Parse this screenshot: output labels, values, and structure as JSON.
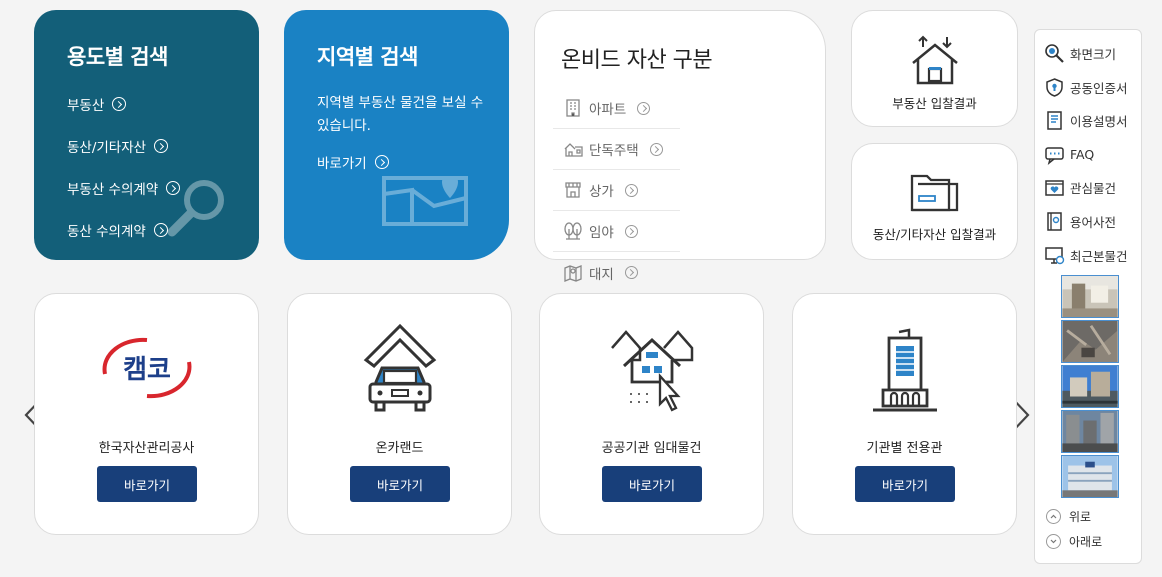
{
  "usage_search": {
    "title": "용도별 검색",
    "links": [
      "부동산",
      "동산/기타자산",
      "부동산 수의계약",
      "동산 수의계약"
    ]
  },
  "region_search": {
    "title": "지역별 검색",
    "description": "지역별 부동산 물건을 보실 수 있습니다.",
    "go_label": "바로가기"
  },
  "asset_types": {
    "title": "온비드 자산 구분",
    "items": [
      {
        "label": "아파트",
        "icon": "apartment-icon"
      },
      {
        "label": "단독주택",
        "icon": "house-icon"
      },
      {
        "label": "상가",
        "icon": "store-icon"
      },
      {
        "label": "임야",
        "icon": "forest-icon"
      },
      {
        "label": "대지",
        "icon": "land-icon"
      }
    ]
  },
  "results": {
    "realestate": "부동산 입찰결과",
    "movable": "동산/기타자산 입찰결과"
  },
  "quick_menu": {
    "items": [
      "화면크기",
      "공동인증서",
      "이용설명서",
      "FAQ",
      "관심물건",
      "용어사전",
      "최근본물건"
    ],
    "up_label": "위로",
    "down_label": "아래로"
  },
  "shortcuts": [
    {
      "title": "한국자산관리공사",
      "button": "바로가기",
      "logo_text": "캠코"
    },
    {
      "title": "온카랜드",
      "button": "바로가기"
    },
    {
      "title": "공공기관 임대물건",
      "button": "바로가기"
    },
    {
      "title": "기관별 전용관",
      "button": "바로가기"
    }
  ],
  "colors": {
    "usage_bg": "#135f79",
    "region_bg": "#1a82c4",
    "button_bg": "#183f7a",
    "kamco_red": "#d8262d",
    "kamco_navy": "#1d3f8a"
  }
}
